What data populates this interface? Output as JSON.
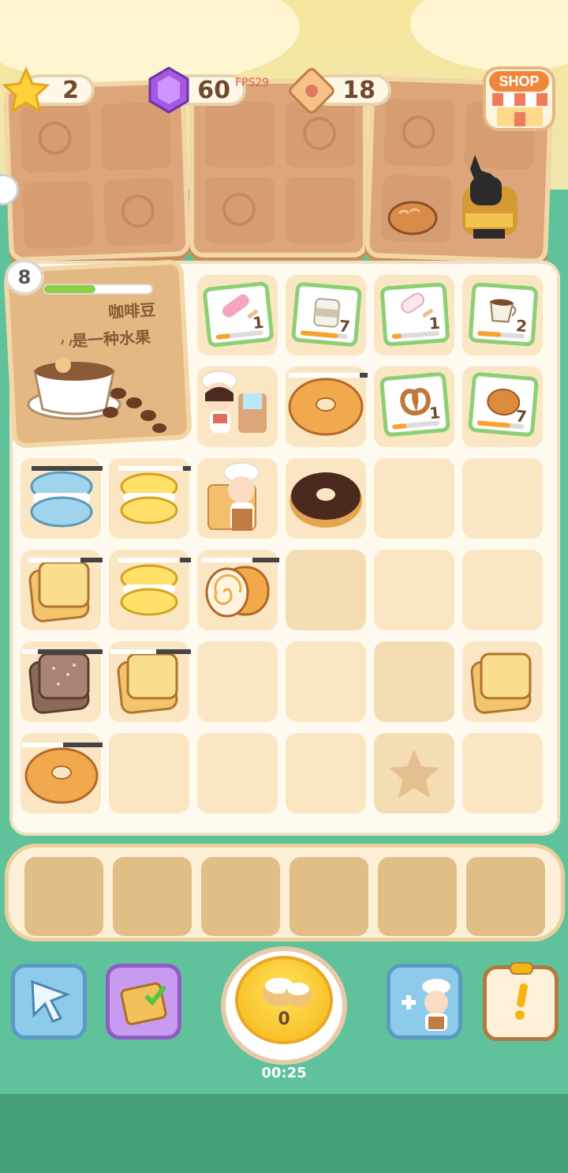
{
  "resources": {
    "stars": "2",
    "gems": "60",
    "tickets": "18"
  },
  "debug": {
    "fps": "FPS29"
  },
  "shop": {
    "label": "SHOP"
  },
  "order": {
    "level": "8",
    "progress": 0.48,
    "text_line1": "咖啡豆",
    "text_line2": "是一种水果"
  },
  "board": {
    "row1_cards": [
      {
        "item": "popsicle",
        "level": "1"
      },
      {
        "item": "milk",
        "level": "7"
      },
      {
        "item": "ice-cream-bar",
        "level": "1"
      },
      {
        "item": "coffee-cup",
        "level": "2"
      }
    ],
    "row2_cards": [
      {
        "item": "pretzel",
        "level": "1"
      },
      {
        "item": "bun",
        "level": "7"
      }
    ]
  },
  "bottom": {
    "main_count": "0",
    "timer": "00:25"
  },
  "colors": {
    "accent": "#f5b515",
    "green": "#5fc29a",
    "wood": "#dca67a"
  }
}
